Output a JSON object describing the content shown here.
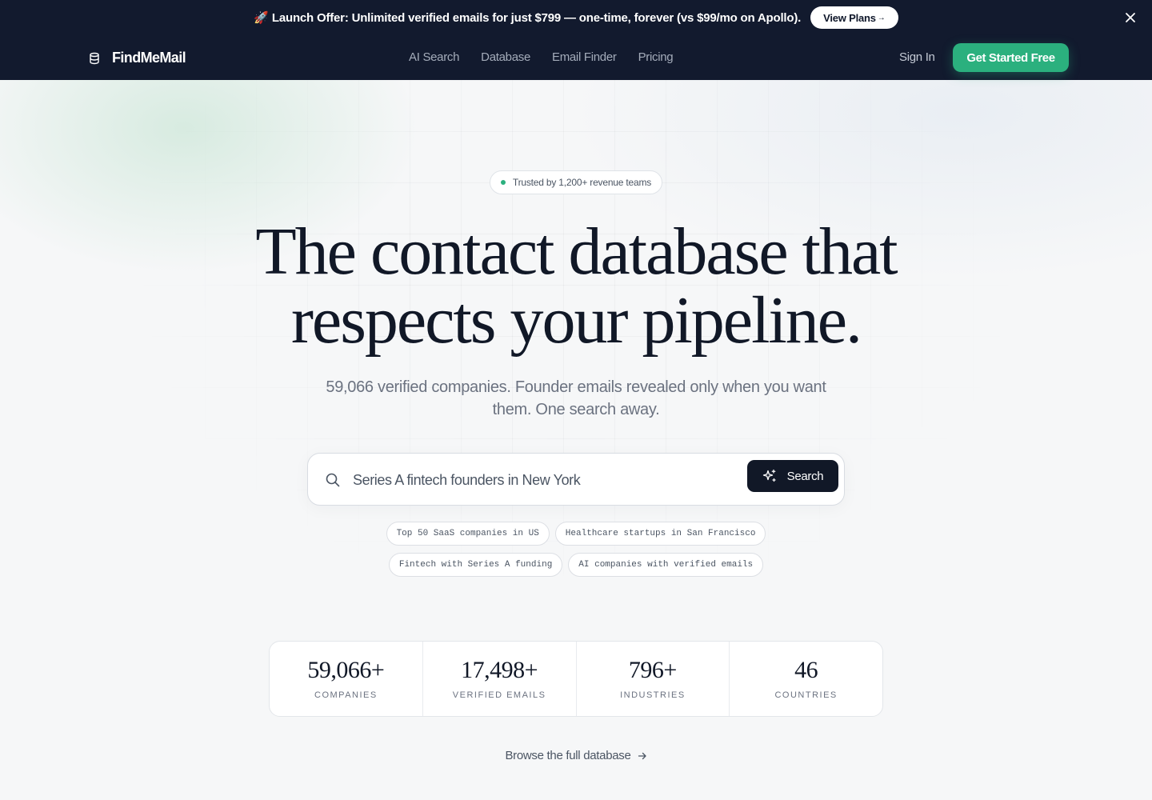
{
  "promo": {
    "text": "Launch Offer: Unlimited verified emails for just $799 — one-time, forever (vs $99/mo on Apollo).",
    "rocket": "🚀",
    "cta_label": "View Plans",
    "cta_arrow": "→"
  },
  "nav": {
    "brand": "FindMeMail",
    "links": [
      "AI Search",
      "Database",
      "Email Finder",
      "Pricing"
    ],
    "sign_in": "Sign In",
    "cta": "Get Started Free"
  },
  "hero": {
    "badge": "Trusted by 1,200+ revenue teams",
    "headline_line1": "The contact database that",
    "headline_line2": "respects your pipeline.",
    "subtitle": "59,066 verified companies. Founder emails revealed only when you want them. One search away."
  },
  "search": {
    "placeholder": "Series A fintech founders in New York",
    "button_label": "Search",
    "suggestions": [
      "Top 50 SaaS companies in US",
      "Healthcare startups in San Francisco",
      "Fintech with Series A funding",
      "AI companies with verified emails"
    ]
  },
  "stats": [
    {
      "value": "59,066+",
      "label": "COMPANIES"
    },
    {
      "value": "17,498+",
      "label": "VERIFIED EMAILS"
    },
    {
      "value": "796+",
      "label": "INDUSTRIES"
    },
    {
      "value": "46",
      "label": "COUNTRIES"
    }
  ],
  "browse": {
    "label": "Browse the full database"
  },
  "colors": {
    "header_bg": "#121a2e",
    "accent_green": "#2bb07e",
    "dark_button": "#111827"
  },
  "icons": [
    "rocket-icon",
    "close-icon",
    "database-icon",
    "search-icon",
    "sparkle-icon",
    "arrow-right-icon"
  ]
}
